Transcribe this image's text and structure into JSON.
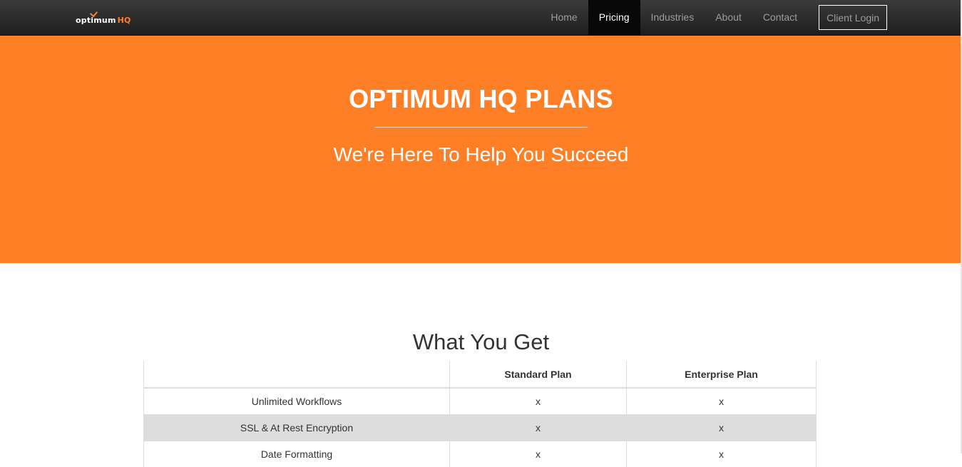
{
  "navbar": {
    "logo": {
      "name": "optimum",
      "suffix": "HQ"
    },
    "items": [
      {
        "label": "Home",
        "active": false
      },
      {
        "label": "Pricing",
        "active": true
      },
      {
        "label": "Industries",
        "active": false
      },
      {
        "label": "About",
        "active": false
      },
      {
        "label": "Contact",
        "active": false
      }
    ],
    "login_label": "Client Login"
  },
  "hero": {
    "title": "OPTIMUM HQ PLANS",
    "subtitle": "We're Here To Help You Succeed",
    "background_color": "#ff7f27"
  },
  "section": {
    "title": "What You Get",
    "table": {
      "headers": [
        "",
        "Standard Plan",
        "Enterprise Plan"
      ],
      "rows": [
        {
          "feature": "Unlimited Workflows",
          "standard": "x",
          "enterprise": "x"
        },
        {
          "feature": "SSL & At Rest Encryption",
          "standard": "x",
          "enterprise": "x"
        },
        {
          "feature": "Date Formatting",
          "standard": "x",
          "enterprise": "x"
        }
      ]
    }
  },
  "colors": {
    "accent": "#ff7f27",
    "navbar": "#222222",
    "stripe": "#dddddd"
  }
}
